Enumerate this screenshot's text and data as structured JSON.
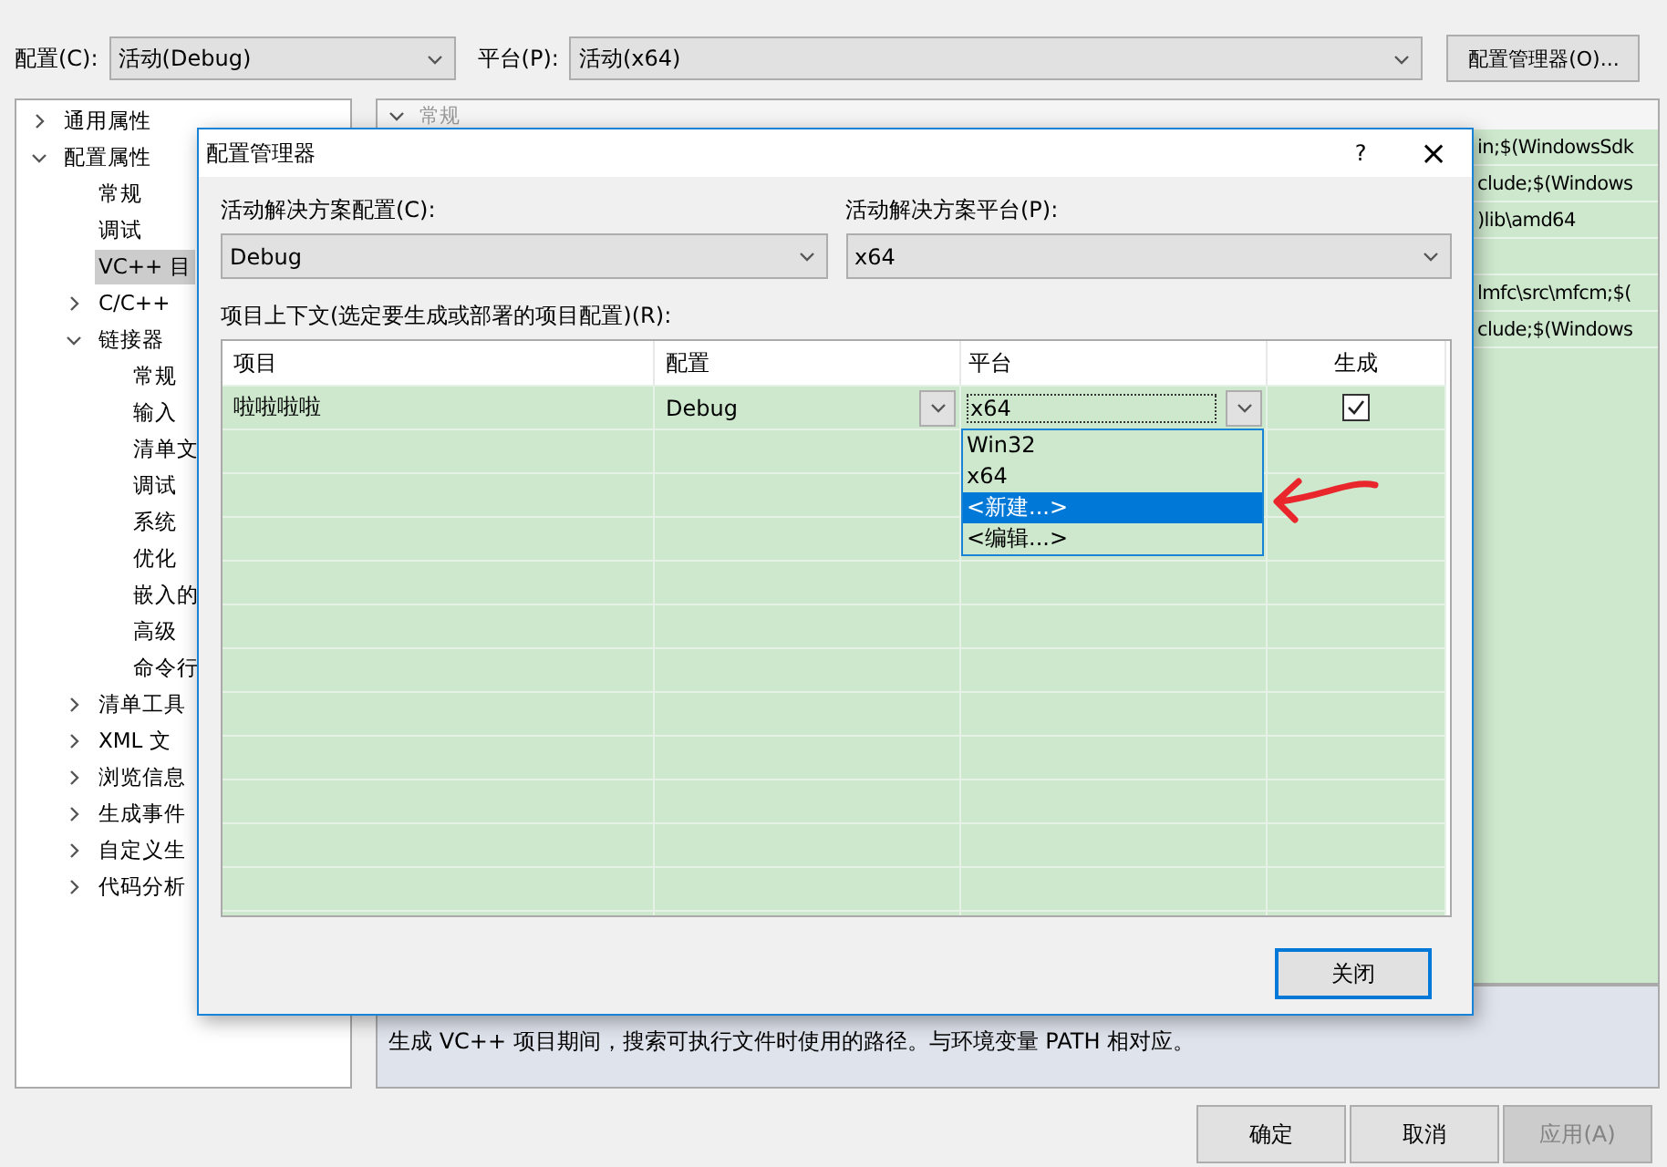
{
  "toolbar": {
    "config_label": "配置(C):",
    "config_value": "活动(Debug)",
    "platform_label": "平台(P):",
    "platform_value": "活动(x64)",
    "manager_button": "配置管理器(O)..."
  },
  "tree": [
    {
      "label": "通用属性",
      "expanded": false,
      "selected": false
    },
    {
      "label": "配置属性",
      "expanded": true,
      "selected": false,
      "children": [
        {
          "label": "常规",
          "selected": false
        },
        {
          "label": "调试",
          "selected": false
        },
        {
          "label": "VC++ 目",
          "selected": true
        },
        {
          "label": "C/C++",
          "expanded": false,
          "selected": false
        },
        {
          "label": "链接器",
          "expanded": true,
          "selected": false,
          "children": [
            {
              "label": "常规",
              "selected": false
            },
            {
              "label": "输入",
              "selected": false
            },
            {
              "label": "清单文",
              "selected": false
            },
            {
              "label": "调试",
              "selected": false
            },
            {
              "label": "系统",
              "selected": false
            },
            {
              "label": "优化",
              "selected": false
            },
            {
              "label": "嵌入的",
              "selected": false
            },
            {
              "label": "高级",
              "selected": false
            },
            {
              "label": "命令行",
              "selected": false
            }
          ]
        },
        {
          "label": "清单工具",
          "expanded": false,
          "selected": false
        },
        {
          "label": "XML 文",
          "expanded": false,
          "selected": false
        },
        {
          "label": "浏览信息",
          "expanded": false,
          "selected": false
        },
        {
          "label": "生成事件",
          "expanded": false,
          "selected": false
        },
        {
          "label": "自定义生",
          "expanded": false,
          "selected": false
        },
        {
          "label": "代码分析",
          "expanded": false,
          "selected": false
        }
      ]
    }
  ],
  "properties": {
    "section": "常规",
    "rows": [
      {
        "value": "in;$(WindowsSdk"
      },
      {
        "value": "clude;$(Windows"
      },
      {
        "value": ")lib\\amd64"
      },
      {},
      {
        "value": "lmfc\\src\\mfcm;$("
      },
      {
        "value": "clude;$(Windows"
      }
    ]
  },
  "description": "生成 VC++ 项目期间，搜索可执行文件时使用的路径。与环境变量 PATH 相对应。",
  "buttons": [
    {
      "label": "确定",
      "disabled": false
    },
    {
      "label": "取消",
      "disabled": false
    },
    {
      "label": "应用(A)",
      "disabled": true
    }
  ],
  "dialog": {
    "title": "配置管理器",
    "help": "?",
    "close": "×",
    "solution_config_label": "活动解决方案配置(C):",
    "solution_config_value": "Debug",
    "solution_platform_label": "活动解决方案平台(P):",
    "solution_platform_value": "x64",
    "context_label": "项目上下文(选定要生成或部署的项目配置)(R):",
    "columns": [
      "项目",
      "配置",
      "平台",
      "生成"
    ],
    "rows": [
      {
        "project": "啦啦啦啦",
        "config": "Debug",
        "platform": "x64",
        "build": true
      }
    ],
    "platform_options": [
      {
        "label": "Win32",
        "selected": false
      },
      {
        "label": "x64",
        "selected": false
      },
      {
        "label": "<新建...>",
        "selected": true
      },
      {
        "label": "<编辑...>",
        "selected": false
      }
    ],
    "close_button": "关闭"
  }
}
